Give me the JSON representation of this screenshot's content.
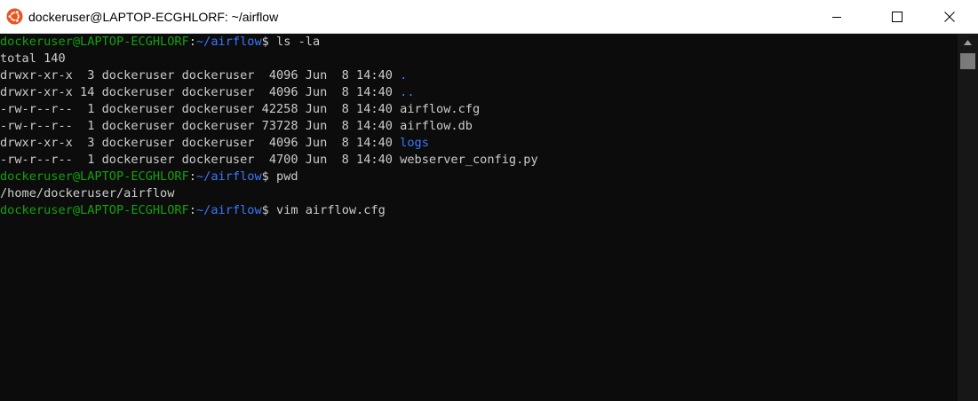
{
  "window": {
    "title": "dockeruser@LAPTOP-ECGHLORF: ~/airflow"
  },
  "icons": {
    "app": "ubuntu-icon",
    "minimize": "minimize-icon",
    "maximize": "maximize-icon",
    "close": "close-icon",
    "scroll_up": "chevron-up-icon"
  },
  "colors": {
    "background": "#0c0c0c",
    "text": "#cccccc",
    "prompt_user": "#13a10e",
    "prompt_path": "#3b78ff",
    "directory": "#3b78ff",
    "ubuntu_orange": "#e95420"
  },
  "terminal": {
    "prompt_user": "dockeruser@LAPTOP-ECGHLORF",
    "prompt_sep": ":",
    "prompt_path": "~/airflow",
    "prompt_end": "$ ",
    "commands": [
      "ls -la",
      "pwd",
      "vim airflow.cfg"
    ],
    "total": "total 140",
    "listing": [
      {
        "meta": "drwxr-xr-x  3 dockeruser dockeruser  4096 Jun  8 14:40 ",
        "name": ".",
        "is_dir": true
      },
      {
        "meta": "drwxr-xr-x 14 dockeruser dockeruser  4096 Jun  8 14:40 ",
        "name": "..",
        "is_dir": true
      },
      {
        "meta": "-rw-r--r--  1 dockeruser dockeruser 42258 Jun  8 14:40 ",
        "name": "airflow.cfg",
        "is_dir": false
      },
      {
        "meta": "-rw-r--r--  1 dockeruser dockeruser 73728 Jun  8 14:40 ",
        "name": "airflow.db",
        "is_dir": false
      },
      {
        "meta": "drwxr-xr-x  3 dockeruser dockeruser  4096 Jun  8 14:40 ",
        "name": "logs",
        "is_dir": true
      },
      {
        "meta": "-rw-r--r--  1 dockeruser dockeruser  4700 Jun  8 14:40 ",
        "name": "webserver_config.py",
        "is_dir": false
      }
    ],
    "pwd_output": "/home/dockeruser/airflow"
  }
}
